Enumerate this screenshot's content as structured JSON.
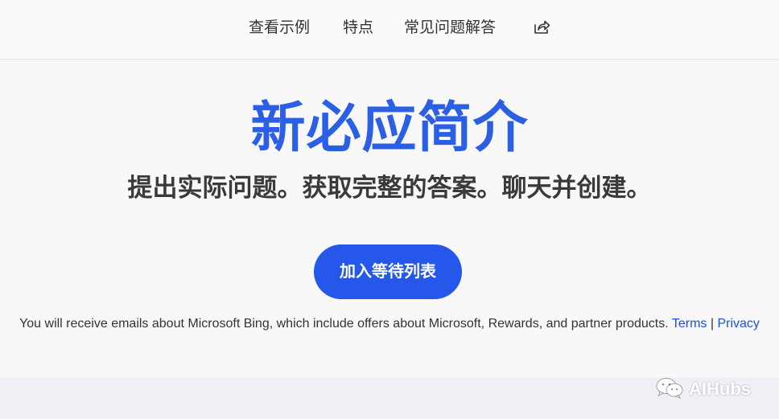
{
  "nav": {
    "items": [
      {
        "label": "查看示例"
      },
      {
        "label": "特点"
      },
      {
        "label": "常见问题解答"
      }
    ],
    "share_icon": "share-icon"
  },
  "hero": {
    "title": "新必应简介",
    "subtitle": "提出实际问题。获取完整的答案。聊天并创建。",
    "title_color": "#2a5fe6"
  },
  "cta": {
    "label": "加入等待列表",
    "color": "#2457ea"
  },
  "disclaimer": {
    "text": "You will receive emails about Microsoft Bing, which include offers about Microsoft, Rewards, and partner products.",
    "terms": "Terms",
    "separator": "|",
    "privacy": "Privacy",
    "link_color": "#1c4fe0"
  },
  "watermark": {
    "icon": "wechat-icon",
    "text": "AIHubs"
  }
}
